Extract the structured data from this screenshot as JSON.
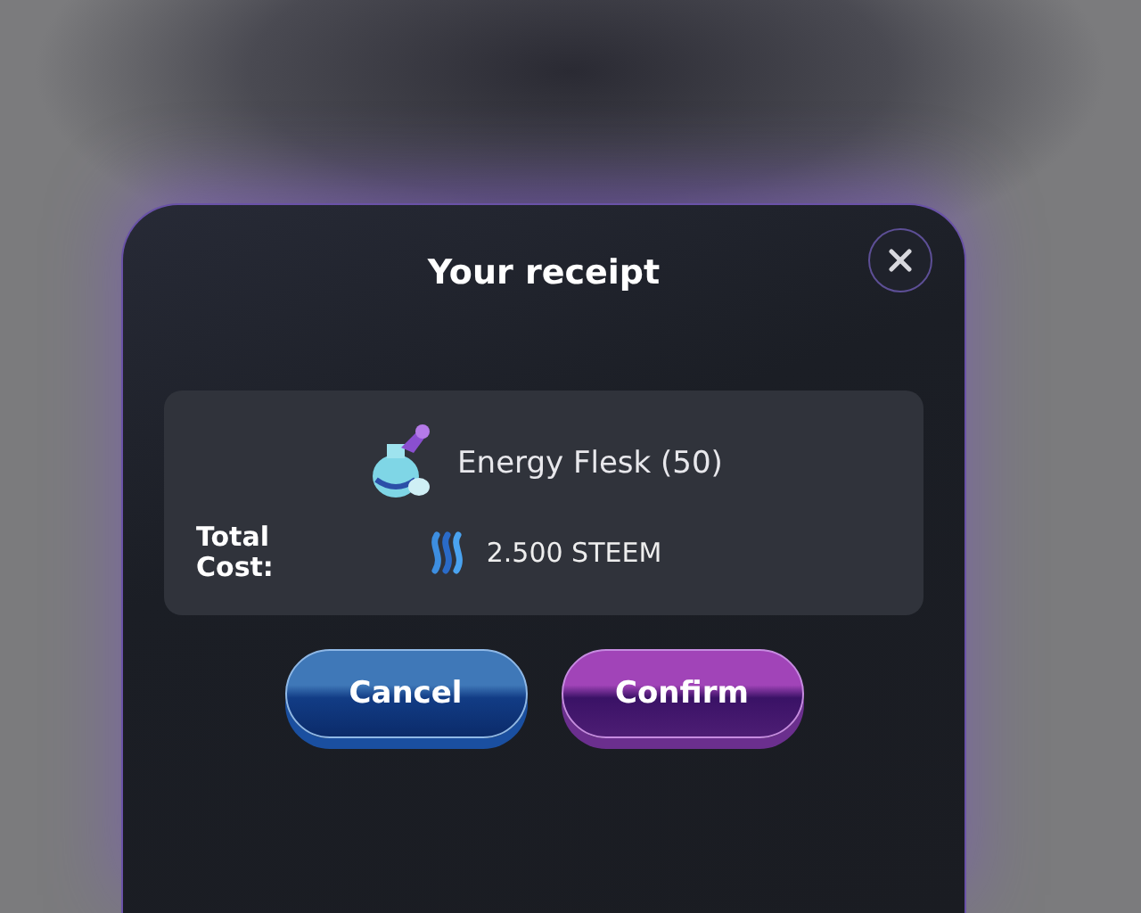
{
  "dialog": {
    "title": "Your receipt",
    "item": {
      "name": "Energy Flesk (50)"
    },
    "total": {
      "label": "Total Cost:",
      "amount": "2.500 STEEM"
    },
    "buttons": [
      {
        "label": "Cancel",
        "kind": "cancel"
      },
      {
        "label": "Confirm",
        "kind": "confirm"
      }
    ]
  }
}
